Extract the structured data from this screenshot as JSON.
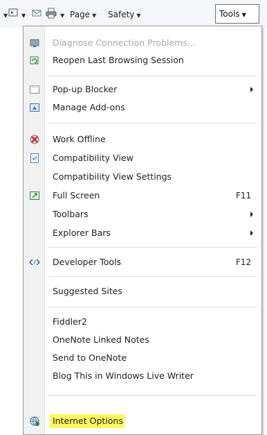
{
  "commandbar": {
    "page_label": "Page",
    "safety_label": "Safety",
    "tools_label": "Tools"
  },
  "menu": {
    "diagnose": "Diagnose Connection Problems...",
    "reopen": "Reopen Last Browsing Session",
    "popup_blocker": "Pop-up Blocker",
    "manage_addons": "Manage Add-ons",
    "work_offline": "Work Offline",
    "compat_view": "Compatibility View",
    "compat_settings": "Compatibility View Settings",
    "full_screen": "Full Screen",
    "full_screen_key": "F11",
    "toolbars": "Toolbars",
    "explorer_bars": "Explorer Bars",
    "dev_tools": "Developer Tools",
    "dev_tools_key": "F12",
    "suggested_sites": "Suggested Sites",
    "fiddler": "Fiddler2",
    "onenote_linked": "OneNote Linked Notes",
    "send_onenote": "Send to OneNote",
    "blog_this": "Blog This in Windows Live Writer",
    "internet_options": "Internet Options"
  },
  "colors": {
    "highlight": "#fbf85e",
    "disabled_text": "#a8a8a8"
  }
}
